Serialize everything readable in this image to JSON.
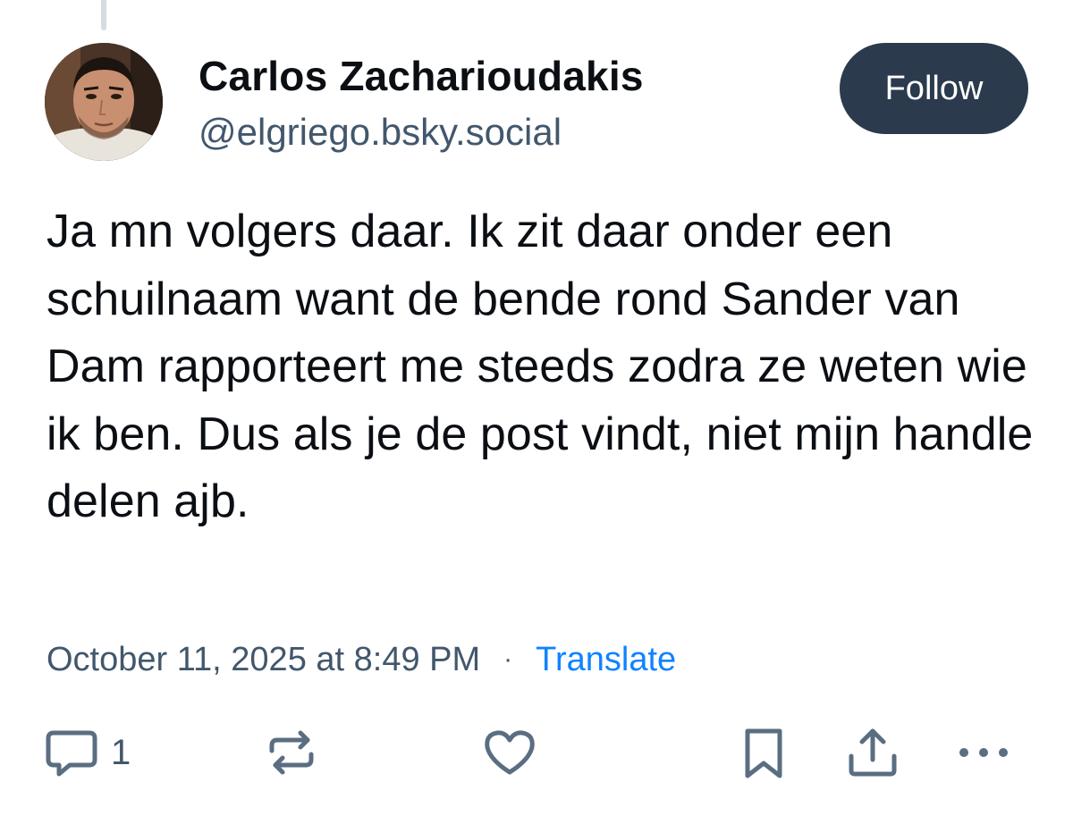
{
  "post": {
    "author": {
      "name": "Carlos Zacharioudakis",
      "handle": "@elgriego.bsky.social"
    },
    "follow_label": "Follow",
    "text": "Ja mn volgers daar. Ik zit daar onder een schuilnaam want de bende rond Sander van Dam rapporteert me steeds zodra ze weten wie ik ben. Dus als je de post vindt, niet mijn handle delen ajb.",
    "timestamp": "October 11, 2025 at 8:49 PM",
    "separator": "·",
    "translate_label": "Translate"
  },
  "actions": {
    "reply_count": "1",
    "icons": [
      "reply-icon",
      "repost-icon",
      "like-icon",
      "bookmark-icon",
      "share-icon",
      "more-icon"
    ]
  },
  "colors": {
    "follow_button_bg": "#2b3a4d",
    "handle_gray": "#42576c",
    "link_blue": "#1083fe",
    "icon_gray": "#5a6e82"
  }
}
